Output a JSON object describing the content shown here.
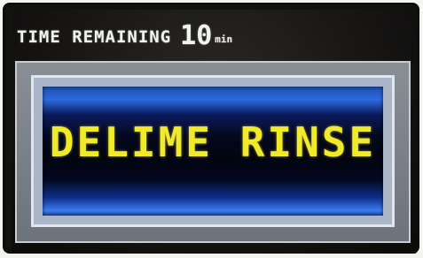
{
  "header": {
    "label": "TIME REMAINING",
    "value": "10",
    "unit": "min"
  },
  "display": {
    "message": "DELIME RINSE"
  },
  "colors": {
    "header_text": "#f2f2ee",
    "message_text": "#f0ea2a",
    "panel_blue": "#2d6ae0",
    "frame_gray": "#8a8f96"
  }
}
